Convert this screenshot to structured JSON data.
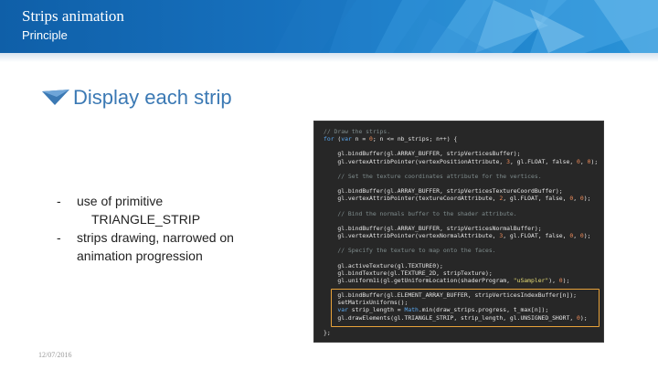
{
  "header": {
    "title": "Strips animation",
    "subtitle": "Principle"
  },
  "slide": {
    "heading": "Display each strip",
    "heading_icon": "blue-pennant-arrow-icon",
    "bullets": [
      {
        "dash": "-",
        "lines": [
          "use of primitive",
          "TRIANGLE_STRIP"
        ]
      },
      {
        "dash": "-",
        "lines": [
          "strips drawing, narrowed on",
          "animation progression"
        ]
      }
    ],
    "date": "12/07/2016"
  },
  "code_lines": [
    "// Draw the strips.",
    "for (var n = 0; n <= nb_strips; n++) {",
    "",
    "    gl.bindBuffer(gl.ARRAY_BUFFER, stripVerticesBuffer);",
    "    gl.vertexAttribPointer(vertexPositionAttribute, 3, gl.FLOAT, false, 0, 0);",
    "",
    "    // Set the texture coordinates attribute for the vertices.",
    "",
    "    gl.bindBuffer(gl.ARRAY_BUFFER, stripVerticesTextureCoordBuffer);",
    "    gl.vertexAttribPointer(textureCoordAttribute, 2, gl.FLOAT, false, 0, 0);",
    "",
    "    // Bind the normals buffer to the shader attribute.",
    "",
    "    gl.bindBuffer(gl.ARRAY_BUFFER, stripVerticesNormalBuffer);",
    "    gl.vertexAttribPointer(vertexNormalAttribute, 3, gl.FLOAT, false, 0, 0);",
    "",
    "    // Specify the texture to map onto the faces.",
    "",
    "    gl.activeTexture(gl.TEXTURE0);",
    "    gl.bindTexture(gl.TEXTURE_2D, stripTexture);",
    "    gl.uniform1i(gl.getUniformLocation(shaderProgram, \"uSampler\"), 0);",
    "",
    "    gl.bindBuffer(gl.ELEMENT_ARRAY_BUFFER, stripVerticesIndexBuffer[n]);",
    "    setMatrixUniforms();",
    "    var strip_length = Math.min(draw_strips.progress, t_max[n]);",
    "    gl.drawElements(gl.TRIANGLE_STRIP, strip_length, gl.UNSIGNED_SHORT, 0);",
    "",
    "};"
  ],
  "colors": {
    "header_blue": "#1a7cc6",
    "heading_blue": "#3b79b4",
    "code_bg": "#272727",
    "highlight_orange": "#e8a23a"
  }
}
